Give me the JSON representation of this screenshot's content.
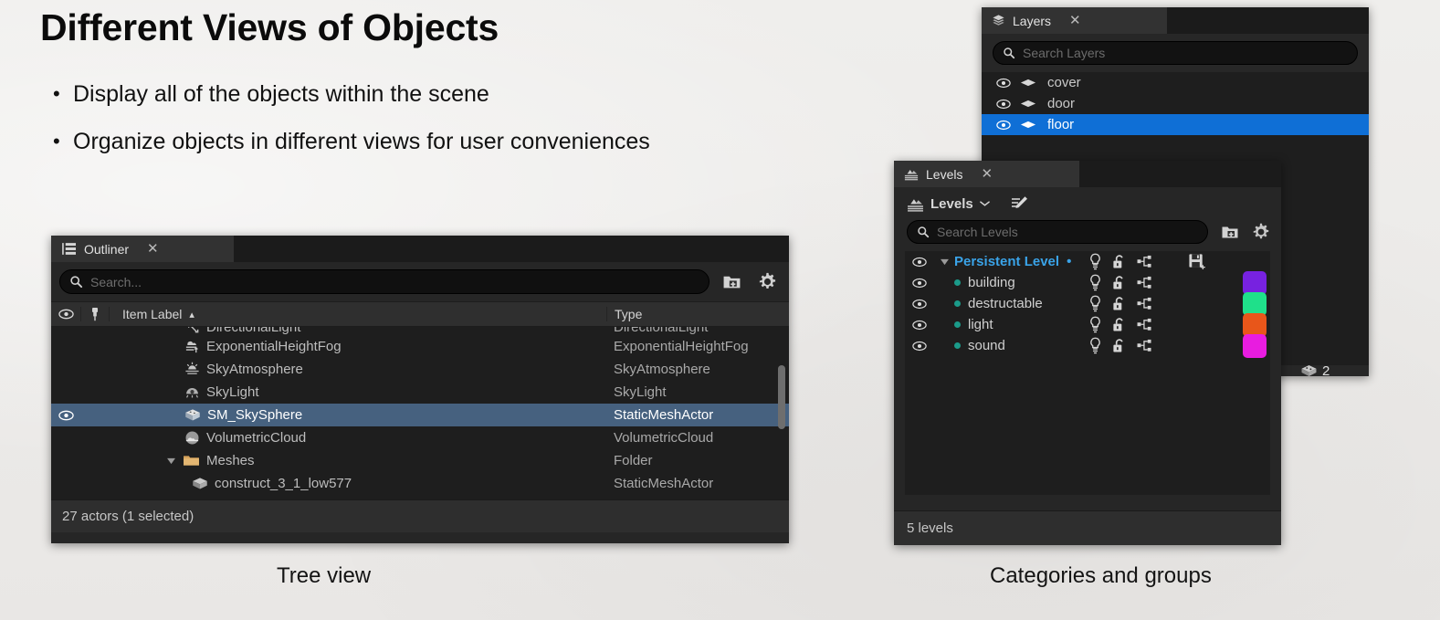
{
  "slide": {
    "title": "Different Views of Objects",
    "bullets": [
      "Display all of the objects within the scene",
      "Organize objects in different views for user conveniences"
    ],
    "bullet_marker": "•",
    "captions": {
      "left": "Tree view",
      "right": "Categories and groups"
    },
    "background_color": "#eceae8"
  },
  "outliner": {
    "tab_title": "Outliner",
    "close_label": "✕",
    "search_placeholder": "Search...",
    "columns": {
      "item_label": "Item Label",
      "type": "Type",
      "sort_arrow": "▴"
    },
    "rows": [
      {
        "label": "DirectionalLight",
        "type": "DirectionalLight",
        "icon": "directional-light-icon",
        "indent": 0,
        "selected": false,
        "eye": false
      },
      {
        "label": "ExponentialHeightFog",
        "type": "ExponentialHeightFog",
        "icon": "height-fog-icon",
        "indent": 0,
        "selected": false,
        "eye": false
      },
      {
        "label": "SkyAtmosphere",
        "type": "SkyAtmosphere",
        "icon": "sky-atmosphere-icon",
        "indent": 0,
        "selected": false,
        "eye": false
      },
      {
        "label": "SkyLight",
        "type": "SkyLight",
        "icon": "sky-light-icon",
        "indent": 0,
        "selected": false,
        "eye": false
      },
      {
        "label": "SM_SkySphere",
        "type": "StaticMeshActor",
        "icon": "static-mesh-icon",
        "indent": 0,
        "selected": true,
        "eye": true
      },
      {
        "label": "VolumetricCloud",
        "type": "VolumetricCloud",
        "icon": "volumetric-cloud-icon",
        "indent": 0,
        "selected": false,
        "eye": false
      },
      {
        "label": "Meshes",
        "type": "Folder",
        "icon": "folder-icon",
        "indent": -1,
        "selected": false,
        "eye": false
      },
      {
        "label": "construct_3_1_low577",
        "type": "StaticMeshActor",
        "icon": "static-mesh-icon",
        "indent": 1,
        "selected": false,
        "eye": false
      }
    ],
    "status_text": "27 actors (1 selected)",
    "toolbar_icons": [
      "new-folder-icon",
      "settings-gear-icon"
    ],
    "selection_color": "#46617f"
  },
  "layers": {
    "tab_title": "Layers",
    "close_label": "✕",
    "search_placeholder": "Search Layers",
    "rows": [
      {
        "name": "cover",
        "selected": false
      },
      {
        "name": "door",
        "selected": false
      },
      {
        "name": "floor",
        "selected": true
      }
    ],
    "selection_color": "#0f6fd6",
    "badge": {
      "icon": "cube-icon",
      "count": "2"
    }
  },
  "levels": {
    "tab_title": "Levels",
    "close_label": "✕",
    "toolbar": {
      "menu_label": "Levels",
      "chevron": "⌄",
      "edit_icon": "edit-levels-icon"
    },
    "search_placeholder": "Search Levels",
    "toolbar_icons": [
      "new-level-folder-icon",
      "settings-gear-icon"
    ],
    "rows": [
      {
        "name": "Persistent Level",
        "modified": "•",
        "persistent": true,
        "color": null,
        "has_save": true
      },
      {
        "name": "building",
        "modified": "",
        "persistent": false,
        "color": "#7722e0",
        "has_save": false
      },
      {
        "name": "destructable",
        "modified": "",
        "persistent": false,
        "color": "#1fe08a",
        "has_save": false
      },
      {
        "name": "light",
        "modified": "",
        "persistent": false,
        "color": "#e8561a",
        "has_save": false
      },
      {
        "name": "sound",
        "modified": "",
        "persistent": false,
        "color": "#e81ce0",
        "has_save": false
      }
    ],
    "row_icons": [
      "lightbulb-icon",
      "unlock-icon",
      "streaming-icon"
    ],
    "status_text": "5 levels",
    "persistent_name_color": "#3aa3e8"
  }
}
